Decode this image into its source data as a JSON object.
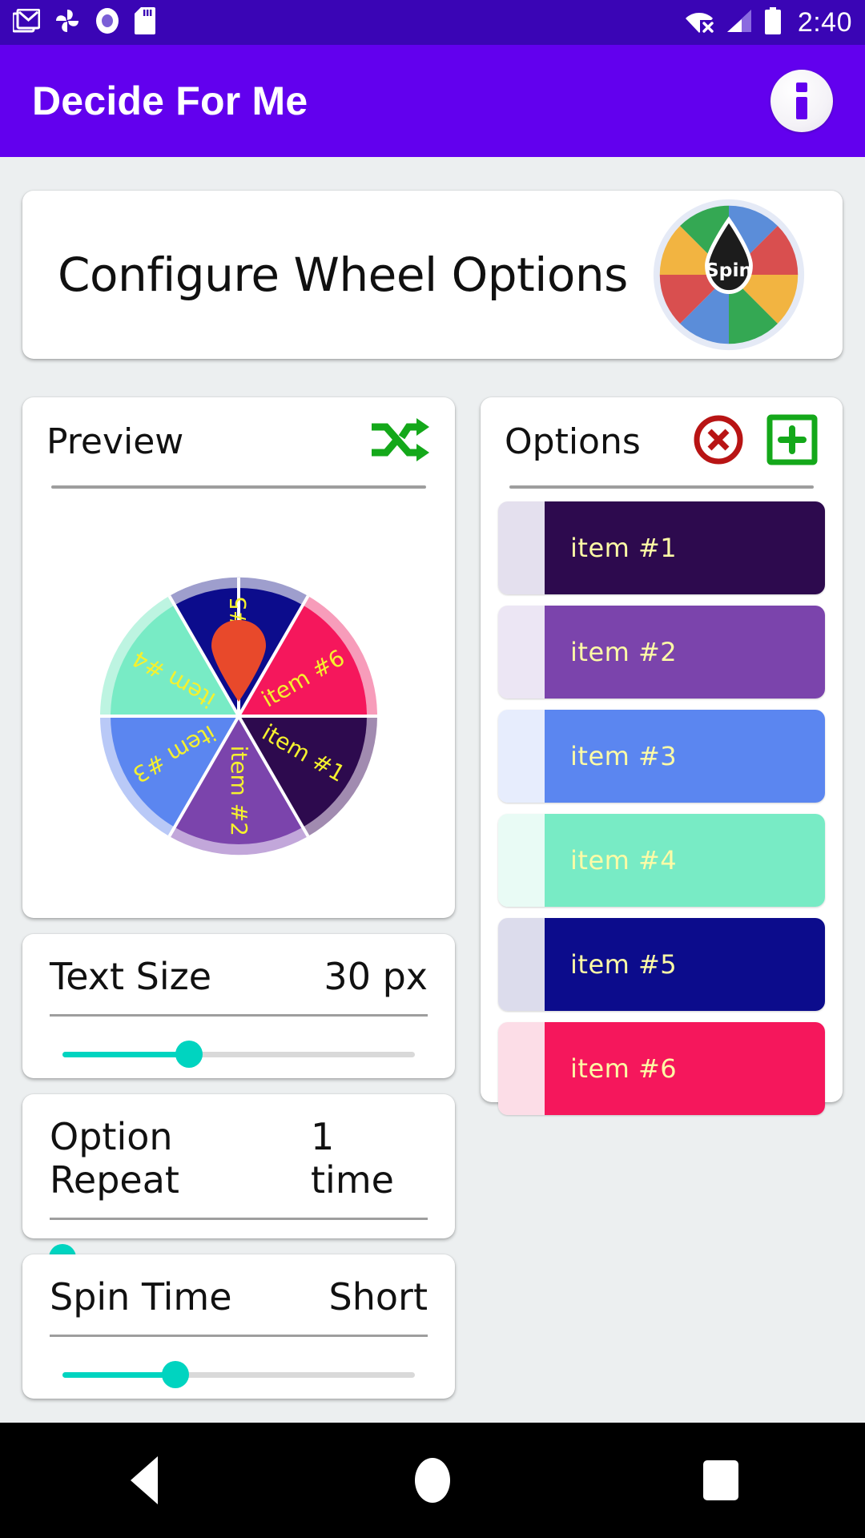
{
  "status_bar": {
    "time": "2:40",
    "left_icons": [
      "gmail-icon",
      "photos-icon",
      "record-circle-icon",
      "sd-card-icon"
    ],
    "right_icons": [
      "wifi-off-icon",
      "cellular-signal-icon",
      "battery-full-icon"
    ],
    "background": "#3a05b5"
  },
  "app_bar": {
    "title": "Decide For Me",
    "background": "#6200ee",
    "info_icon": "info-icon"
  },
  "header_card": {
    "title": "Configure Wheel Options",
    "logo": {
      "name": "spin-wheel-logo",
      "center_label": "Spin",
      "segment_colors": [
        "#5b8dd9",
        "#d94f4f",
        "#f2b441",
        "#34a853",
        "#5b8dd9",
        "#d94f4f",
        "#f2b441",
        "#34a853"
      ],
      "hub_color": "#1c1c1c"
    }
  },
  "preview_card": {
    "title": "Preview",
    "shuffle_icon": "shuffle-icon",
    "shuffle_color": "#14a81a",
    "pointer_color": "#e8492b",
    "wheel": {
      "segments": [
        {
          "label": "item #5",
          "color": "#0c0c8c",
          "ring": "#9e9ecd",
          "start_deg": -30,
          "end_deg": 30
        },
        {
          "label": "item #6",
          "color": "#f5175c",
          "ring": "#f79cba",
          "start_deg": 30,
          "end_deg": 90
        },
        {
          "label": "item #1",
          "color": "#2d0a4e",
          "ring": "#a18bb0",
          "start_deg": 90,
          "end_deg": 150
        },
        {
          "label": "item #2",
          "color": "#7b44ac",
          "ring": "#c2a7da",
          "start_deg": 150,
          "end_deg": 210
        },
        {
          "label": "item #3",
          "color": "#5b86f0",
          "ring": "#b9c9f7",
          "start_deg": 210,
          "end_deg": 270
        },
        {
          "label": "item #4",
          "color": "#78ebc5",
          "ring": "#bdf4e1",
          "start_deg": 270,
          "end_deg": 330
        }
      ],
      "label_color": "#f5f12e",
      "separator_color": "#ffffff"
    }
  },
  "options_card": {
    "title": "Options",
    "delete_icon": "clear-all-icon",
    "delete_color": "#b81414",
    "add_icon": "add-box-icon",
    "add_color": "#14a81a",
    "items": [
      {
        "label": "item #1",
        "color": "#2d0a4e",
        "handle": "#e4e0ee"
      },
      {
        "label": "item #2",
        "color": "#7b44ac",
        "handle": "#ece6f4"
      },
      {
        "label": "item #3",
        "color": "#5b86f0",
        "handle": "#e7edfd"
      },
      {
        "label": "item #4",
        "color": "#78ebc5",
        "handle": "#e9fbf5"
      },
      {
        "label": "item #5",
        "color": "#0c0c8c",
        "handle": "#dcdcec"
      },
      {
        "label": "item #6",
        "color": "#f5175c",
        "handle": "#fcdde7"
      }
    ]
  },
  "sliders": [
    {
      "label": "Text Size",
      "value": "30 px",
      "percent": 36,
      "accent": "#00d4c0"
    },
    {
      "label": "Option Repeat",
      "value": "1 time",
      "percent": 0,
      "accent": "#00d4c0"
    },
    {
      "label": "Spin Time",
      "value": "Short",
      "percent": 32,
      "accent": "#00d4c0"
    }
  ],
  "nav_bar": {
    "back": "back-triangle-icon",
    "home": "home-circle-icon",
    "recents": "recents-square-icon"
  }
}
